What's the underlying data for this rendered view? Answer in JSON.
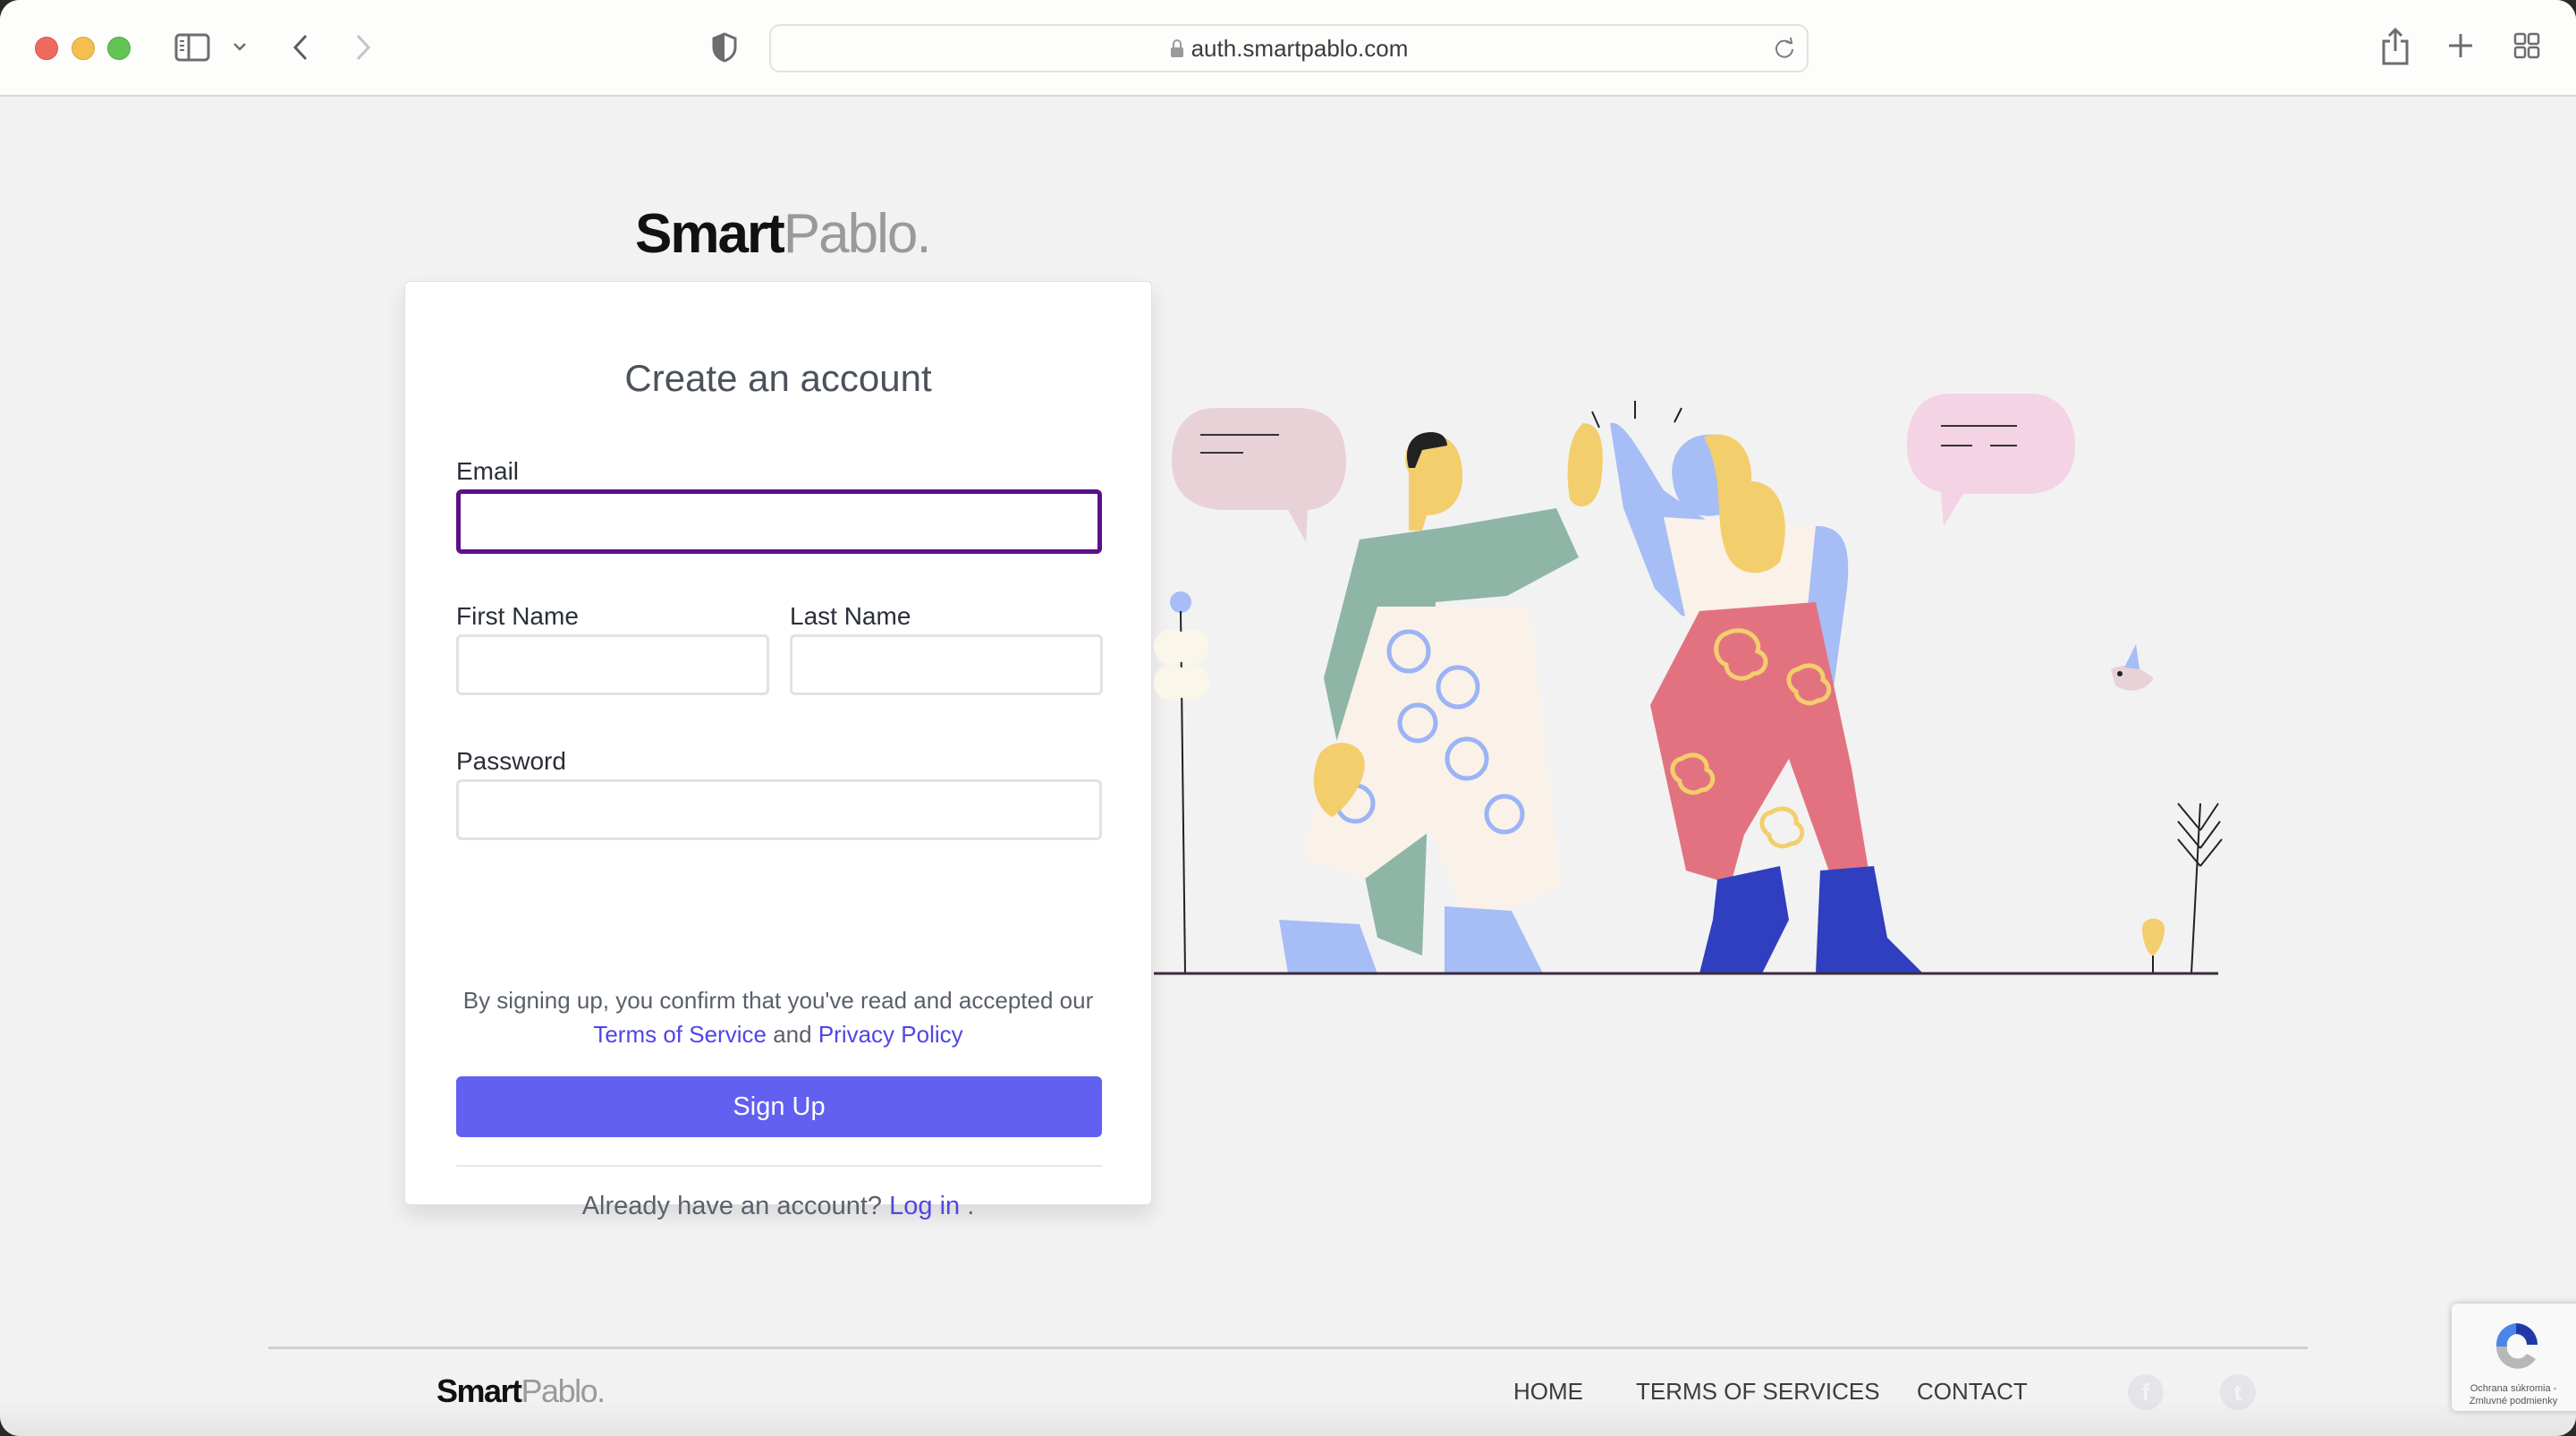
{
  "browser": {
    "url": "auth.smartpablo.com",
    "icons": {
      "sidebar": "sidebar-icon",
      "sidebar_menu": "chevron-down-icon",
      "back": "chevron-left-icon",
      "forward": "chevron-right-icon",
      "privacy": "shield-icon",
      "lock": "lock-icon",
      "reload": "reload-icon",
      "share": "share-icon",
      "new_tab": "plus-icon",
      "tab_overview": "grid-icon"
    }
  },
  "brand": {
    "part1": "Smart",
    "part2": "Pablo."
  },
  "signup": {
    "title": "Create an account",
    "email_label": "Email",
    "email_value": "",
    "first_name_label": "First Name",
    "first_name_value": "",
    "last_name_label": "Last Name",
    "last_name_value": "",
    "password_label": "Password",
    "password_value": "",
    "terms_prefix": "By signing up, you confirm that you've read and accepted our",
    "terms_link": "Terms of Service",
    "terms_and": "and",
    "privacy_link": "Privacy Policy",
    "submit_label": "Sign Up",
    "login_prompt": "Already have an account?",
    "login_link": "Log in",
    "login_suffix": ".",
    "accent_color": "#6160f1",
    "focus_color": "#5b108a"
  },
  "illustration": {
    "description": "two people giving a high five"
  },
  "footer": {
    "links": [
      "HOME",
      "TERMS OF SERVICES",
      "CONTACT"
    ],
    "social": [
      {
        "name": "facebook-icon",
        "glyph": "f"
      },
      {
        "name": "twitter-icon",
        "glyph": "t"
      }
    ]
  },
  "recaptcha": {
    "text": "Ochrana súkromia - Zmluvné podmienky"
  }
}
